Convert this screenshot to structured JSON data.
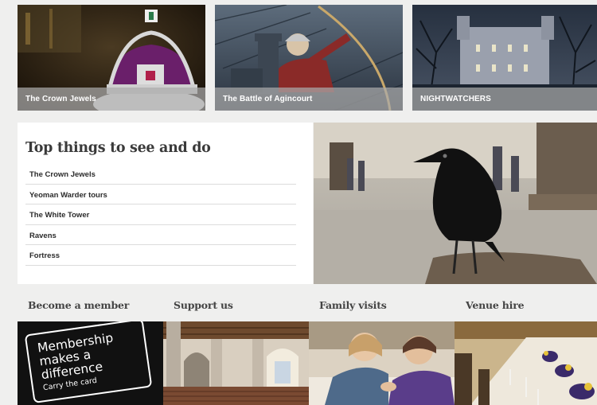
{
  "feature_tiles": [
    {
      "caption": "The Crown Jewels"
    },
    {
      "caption": "The Battle of Agincourt"
    },
    {
      "caption": "NIGHTWATCHERS"
    }
  ],
  "top_things": {
    "title": "Top things to see and do",
    "items": [
      {
        "label": "The Crown Jewels"
      },
      {
        "label": "Yeoman Warder tours"
      },
      {
        "label": "The White Tower"
      },
      {
        "label": "Ravens"
      },
      {
        "label": "Fortress"
      }
    ]
  },
  "bottom_sections": [
    {
      "heading": "Become a member"
    },
    {
      "heading": "Support us"
    },
    {
      "heading": "Family visits"
    },
    {
      "heading": "Venue hire"
    }
  ],
  "membership_card": {
    "line1": "Membership",
    "line2": "makes a",
    "line3": "difference",
    "sub": "Carry the card"
  },
  "icons": {
    "crown": "crown-icon",
    "raven": "raven-icon"
  }
}
